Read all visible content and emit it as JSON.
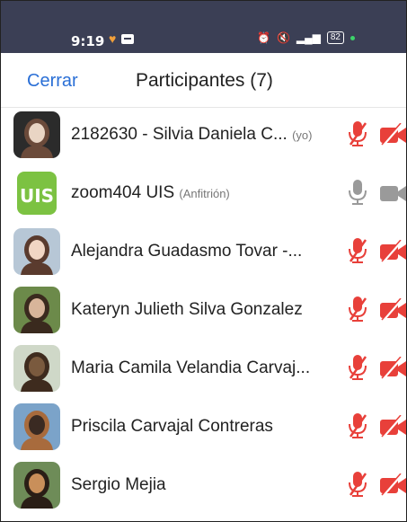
{
  "status_bar": {
    "time": "9:19",
    "battery": "82",
    "colors": {
      "background": "#3b3f55",
      "heart": "#f2a03a",
      "dot": "#3cd46a"
    }
  },
  "header": {
    "close_label": "Cerrar",
    "title": "Participantes (7)",
    "accent": "#2a6fd6"
  },
  "participants": [
    {
      "name": "2182630 - Silvia Daniela C...",
      "tag": "(yo)",
      "mic": "muted",
      "video": "off",
      "avatar": "photo"
    },
    {
      "name": "zoom404 UIS",
      "tag": "(Anfitrión)",
      "mic": "on",
      "video": "on",
      "avatar": "uis-logo"
    },
    {
      "name": "Alejandra Guadasmo Tovar -...",
      "tag": "",
      "mic": "muted",
      "video": "off",
      "avatar": "photo"
    },
    {
      "name": "Kateryn Julieth Silva Gonzalez",
      "tag": "",
      "mic": "muted",
      "video": "off",
      "avatar": "photo"
    },
    {
      "name": "Maria Camila Velandia Carvaj...",
      "tag": "",
      "mic": "muted",
      "video": "off",
      "avatar": "photo"
    },
    {
      "name": "Priscila Carvajal Contreras",
      "tag": "",
      "mic": "muted",
      "video": "off",
      "avatar": "photo"
    },
    {
      "name": "Sergio Mejia",
      "tag": "",
      "mic": "muted",
      "video": "off",
      "avatar": "photo"
    }
  ],
  "colors": {
    "muted_red": "#e8403a",
    "active_gray": "#9a9a9a",
    "uis_green": "#7cc242"
  }
}
